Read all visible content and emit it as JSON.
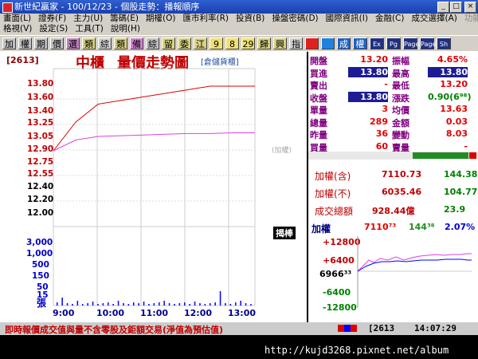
{
  "window": {
    "title": "新世紀贏家 - 100/12/23 - 個股走勢：播報順序",
    "min": "_",
    "max": "□",
    "close": "×"
  },
  "menu": {
    "row1": [
      "畫面(L)",
      "證券(F)",
      "主力(U)",
      "籌碼(E)",
      "期權(O)",
      "匯市利率(R)",
      "投資(B)",
      "操盤密碼(D)",
      "國際資訊(I)",
      "金融(C)",
      "成交選擇(A)",
      "功能操作(E)"
    ],
    "row2": [
      "格視(V)",
      "設定(S)",
      "工具(T)",
      "說明(H)"
    ]
  },
  "toolbar": [
    "加",
    "權",
    "期",
    "價",
    "選",
    "類",
    "綜",
    "類",
    "備",
    "綜",
    "留",
    "委",
    "江",
    "9",
    "8",
    "29",
    "歸",
    "興",
    "指",
    "",
    "",
    "成",
    "權",
    "Ex",
    "Pg",
    "Page",
    "Page",
    "Sh"
  ],
  "chart": {
    "stock_code": "[2613]",
    "market": "中櫃",
    "title": "量價走勢圖",
    "warehouse": "[倉儲貨櫃]",
    "price_labels": [
      "13.80",
      "13.60",
      "13.40",
      "13.25",
      "13.05",
      "12.90",
      "12.75",
      "12.55",
      "12.40",
      "12.20",
      "12.00"
    ],
    "volume_labels": [
      "3,000",
      "1,000",
      "500",
      "150",
      "50",
      "15"
    ],
    "volume_unit": "張",
    "time_labels": [
      "9:00",
      "10:00",
      "11:00",
      "12:00",
      "13:00"
    ],
    "index_tag": "(加權)",
    "status_tag": "揭棒"
  },
  "chart_data": {
    "type": "line",
    "x": [
      "9:00",
      "9:30",
      "10:00",
      "10:30",
      "11:00",
      "11:30",
      "12:00",
      "12:30",
      "13:00",
      "13:30"
    ],
    "series": [
      {
        "name": "price",
        "values": [
          12.9,
          13.3,
          13.55,
          13.6,
          13.65,
          13.7,
          13.75,
          13.8,
          13.8,
          13.8
        ]
      },
      {
        "name": "avg",
        "values": [
          12.9,
          13.05,
          13.1,
          13.11,
          13.12,
          13.13,
          13.14,
          13.14,
          13.15,
          13.15
        ]
      }
    ],
    "ylim": [
      12.0,
      13.8
    ]
  },
  "quote": {
    "rows": [
      {
        "l1": "開盤",
        "v1": "13.20",
        "l2": "振幅",
        "v2": "4.65%"
      },
      {
        "l1": "買進",
        "v1": "13.80",
        "l2": "最高",
        "v2": "13.80"
      },
      {
        "l1": "賣出",
        "v1": "-",
        "l2": "最低",
        "v2": "13.20"
      },
      {
        "l1": "收盤",
        "v1": "13.80",
        "l2": "漲跌",
        "v2": "0.90(6⁹⁸)"
      },
      {
        "l1": "單量",
        "v1": "3",
        "l2": "均價",
        "v2": "13.63"
      },
      {
        "l1": "總量",
        "v1": "289",
        "l2": "金額",
        "v2": "0.03"
      },
      {
        "l1": "昨量",
        "v1": "36",
        "l2": "變動",
        "v2": "8.03"
      },
      {
        "l1": "買量",
        "v1": "60",
        "l2": "賣量",
        "v2": "-"
      }
    ],
    "index_rows": [
      {
        "label": "加權(含)",
        "value": "7110.73",
        "change": "144.38"
      },
      {
        "label": "加權(不)",
        "value": "6035.46",
        "change": "104.77"
      },
      {
        "label": "成交總額",
        "value": "928.44億",
        "change": "23.9"
      }
    ],
    "mini": {
      "title": "加權",
      "value": "7110⁷³",
      "change": "144³⁸",
      "pct": "2.07%",
      "ticks": [
        "+12800",
        "+6400",
        "6966³³",
        "-6400",
        "-12800"
      ]
    }
  },
  "footer": {
    "note": "即時報價成交值與量不含零股及鉅額交易(淨值為預估值)",
    "code": "[2613",
    "time": "14:07:29",
    "url": "http://kujd3268.pixnet.net/album"
  }
}
